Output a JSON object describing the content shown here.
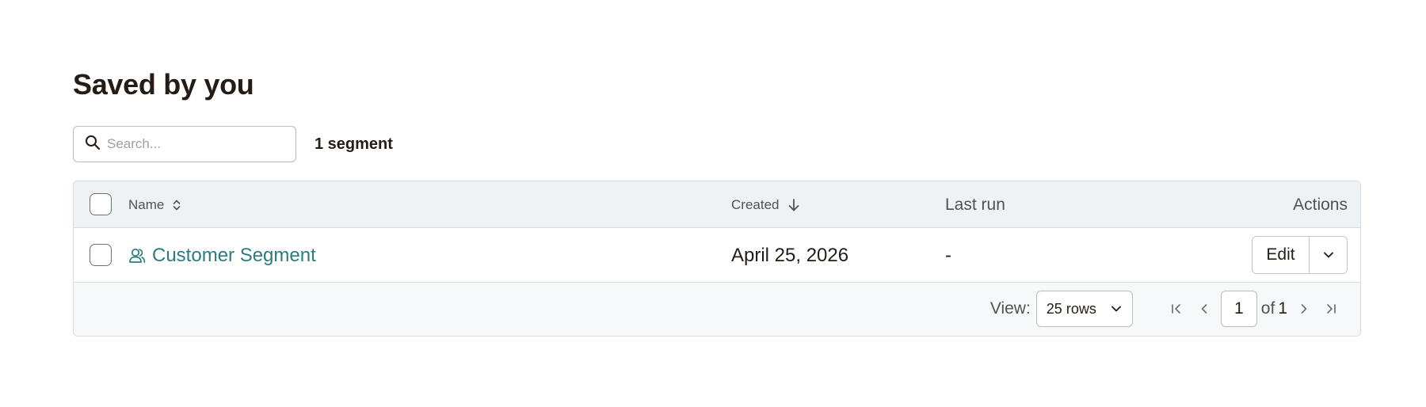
{
  "page": {
    "title": "Saved by you"
  },
  "search": {
    "placeholder": "Search...",
    "value": ""
  },
  "segment_count": "1 segment",
  "table": {
    "columns": {
      "name": "Name",
      "created": "Created",
      "last_run": "Last run",
      "actions": "Actions"
    },
    "rows": [
      {
        "name": "Customer Segment",
        "created": "April 25, 2026",
        "last_run": "-",
        "action_label": "Edit"
      }
    ]
  },
  "pagination": {
    "view_label": "View:",
    "rows_per_page": "25 rows",
    "current_page": "1",
    "of_label": "of",
    "total_pages": "1"
  },
  "colors": {
    "link": "#2c7b80",
    "header_bg": "#eff2f4",
    "text": "#241c15",
    "border": "#d9dcdd"
  },
  "icons": [
    "search-icon",
    "sort-icon",
    "sort-desc-icon",
    "segment-icon",
    "chevron-down-icon",
    "first-page-icon",
    "prev-page-icon",
    "next-page-icon",
    "last-page-icon"
  ]
}
